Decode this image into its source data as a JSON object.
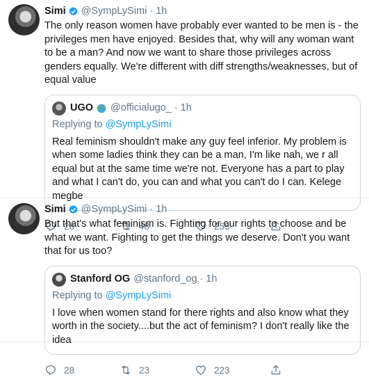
{
  "tweets": [
    {
      "name": "Simi",
      "handle": "@SympLySimi",
      "dot": "·",
      "time": "1h",
      "text": "The only reason women have probably ever wanted to be men is - the privileges men have enjoyed. Besides that, why will any woman want to be a man? And now we want to share those privileges across genders equally. We're different with diff strengths/weaknesses, but of equal value",
      "quote": {
        "name": "UGO",
        "handle": "@officialugo_",
        "dot": "·",
        "time": "1h",
        "replying_prefix": "Replying to",
        "replying_to": "@SympLySimi",
        "text": "Real feminism shouldn't make any guy feel inferior. My problem is when some ladies think they can be a man, I'm like nah, we r all equal but at the same time we're not. Everyone has a part to play and what I can't do, you can and what you can't do I can. Kelege megbe"
      },
      "replies": "28",
      "retweets": "48",
      "likes": "255"
    },
    {
      "name": "Simi",
      "handle": "@SympLySimi",
      "dot": "·",
      "time": "1h",
      "text": "But that's what feminism is. Fighting for our rights to choose and be what we want. Fighting to get the things we deserve. Don't you want that for us too?",
      "quote": {
        "name": "Stanford OG",
        "handle": "@stanford_og",
        "dot": "·",
        "time": "1h",
        "replying_prefix": "Replying to",
        "replying_to": "@SympLySimi",
        "text": "I love when women stand for there rights and also know what they worth in the society....but the act of feminism? I don't really like the idea"
      },
      "replies": "28",
      "retweets": "23",
      "likes": "223"
    }
  ],
  "colors": {
    "verified": "#1da1f2",
    "secondary_text": "#657786",
    "link": "#1da1f2",
    "border": "#ccd6dd"
  }
}
